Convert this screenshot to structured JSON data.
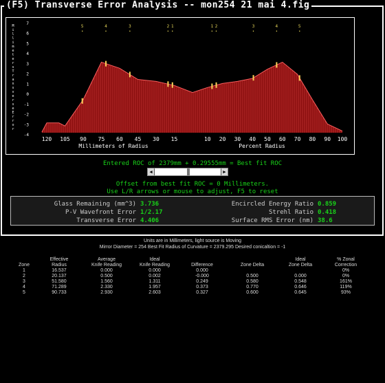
{
  "window": {
    "title": "(F5) Transverse Error Analysis -- mon254 21 mai 4.fig"
  },
  "plot": {
    "y_axis_label": "Millimeters Transverse Error",
    "y_ticks": [
      "7",
      "6",
      "5",
      "4",
      "3",
      "2",
      "1",
      "0",
      "-1",
      "-2",
      "-3",
      "-4"
    ],
    "left_ticks": [
      "120",
      "105",
      "90",
      "75",
      "60",
      "45",
      "30",
      "15"
    ],
    "right_ticks": [
      "10",
      "20",
      "30",
      "40",
      "50",
      "60",
      "70",
      "80",
      "90",
      "100"
    ],
    "left_axis_label": "Millimeters of Radius",
    "right_axis_label": "Percent Radius",
    "zone_markers": [
      "5",
      "4",
      "3",
      "2",
      "1",
      "1",
      "2",
      "3",
      "4",
      "5"
    ]
  },
  "chart_data": {
    "type": "area",
    "title": "",
    "ylabel": "Millimeters Transverse Error",
    "xlabel_left": "Millimeters of Radius",
    "xlabel_right": "Percent Radius",
    "ylim": [
      -4,
      7
    ],
    "grid": false,
    "left_half": {
      "x_mm": [
        124,
        120,
        110,
        105,
        90,
        75,
        60,
        45,
        30,
        15,
        0
      ],
      "y": [
        -3.8,
        -2.9,
        -2.9,
        -3.2,
        -0.6,
        3.1,
        2.5,
        1.4,
        1.2,
        0.8,
        0.1
      ]
    },
    "right_half": {
      "x_percent": [
        0,
        10,
        20,
        30,
        40,
        50,
        60,
        70,
        80,
        90,
        100
      ],
      "y": [
        0.1,
        0.6,
        1.0,
        1.2,
        1.5,
        2.4,
        3.1,
        1.9,
        -0.6,
        -3.0,
        -3.7
      ]
    }
  },
  "controls": {
    "roc_line": "Entered ROC of 2379mm + 0.29555mm = Best fit ROC",
    "offset_line": "Offset from best fit ROC = 0 Millimeters.",
    "help_line": "Use L/R arrows or mouse to adjust, F5 to reset",
    "slider_fraction": 0.5
  },
  "stats": {
    "glass_remaining_label": "Glass Remaining (mm^3)",
    "glass_remaining_value": "3.736",
    "pv_error_label": "P-V Wavefront Error",
    "pv_error_value": "1/2.17",
    "transverse_error_label": "Transverse Error",
    "transverse_error_value": "4.406",
    "encircled_label": "Encircled Energy Ratio",
    "encircled_value": "0.859",
    "strehl_label": "Strehl Ratio",
    "strehl_value": "0.418",
    "surface_rms_label": "Surface RMS Error (nm)",
    "surface_rms_value": "38.6"
  },
  "info": {
    "line1": "Units are in Millimeters, light source is Moving",
    "line2": "Mirror Diameter = 254     Best Fit Radius of Curvature = 2379.295     Desired conicaltion = -1"
  },
  "zone_table": {
    "header_row1": [
      "",
      "Effective",
      "Average",
      "Ideal",
      "",
      "",
      "Ideal",
      "% Zonal"
    ],
    "header_row2": [
      "Zone",
      "Radius",
      "Knife Reading",
      "Knife Reading",
      "Difference",
      "Zone Delta",
      "Zone Delta",
      "Correction"
    ],
    "rows": [
      [
        "1",
        "16.537",
        "0.000",
        "0.000",
        "0.000",
        "",
        "",
        "0%"
      ],
      [
        "2",
        "20.137",
        "0.500",
        "0.002",
        "-0.000",
        "0.500",
        "0.000",
        "0%"
      ],
      [
        "3",
        "51.580",
        "1.560",
        "1.311",
        "0.249",
        "0.580",
        "0.548",
        "161%"
      ],
      [
        "4",
        "71.289",
        "2.330",
        "1.957",
        "0.373",
        "0.770",
        "0.646",
        "119%"
      ],
      [
        "5",
        "90.733",
        "2.930",
        "2.603",
        "0.327",
        "0.600",
        "0.645",
        "93%"
      ]
    ]
  },
  "colors": {
    "background": "#000000",
    "plot_fill": "#8b0f0f",
    "plot_hatch": "#e24b4b",
    "curve": "#ff6060",
    "marker": "#ffd35a",
    "zone_label": "#e8d85a",
    "green_text": "#19d219"
  }
}
